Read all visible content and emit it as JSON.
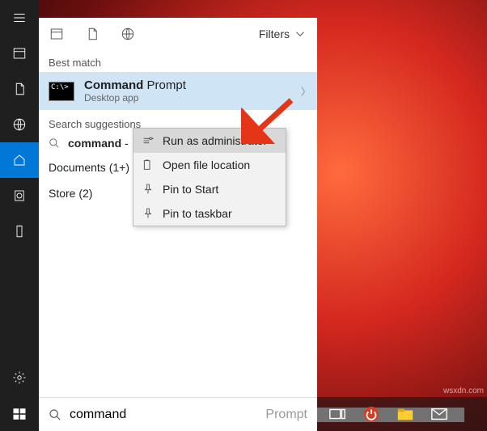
{
  "sidebar": {
    "items": [
      "menu",
      "apps",
      "documents",
      "web",
      "home",
      "clock",
      "usb"
    ],
    "bottom": [
      "settings",
      "user"
    ]
  },
  "panel": {
    "filters_label": "Filters",
    "best_match_label": "Best match",
    "result": {
      "title_bold": "Command",
      "title_rest": " Prompt",
      "subtitle": "Desktop app",
      "icon_text": "C:\\>"
    },
    "suggestions_label": "Search suggestions",
    "suggestion_prefix": "command",
    "suggestion_rest": " -",
    "documents_label": "Documents (1+)",
    "store_label": "Store (2)"
  },
  "context_menu": {
    "items": [
      "Run as administrator",
      "Open file location",
      "Pin to Start",
      "Pin to taskbar"
    ]
  },
  "search": {
    "value": "command",
    "placeholder": "Prompt"
  },
  "watermark": "wsxdn.com"
}
